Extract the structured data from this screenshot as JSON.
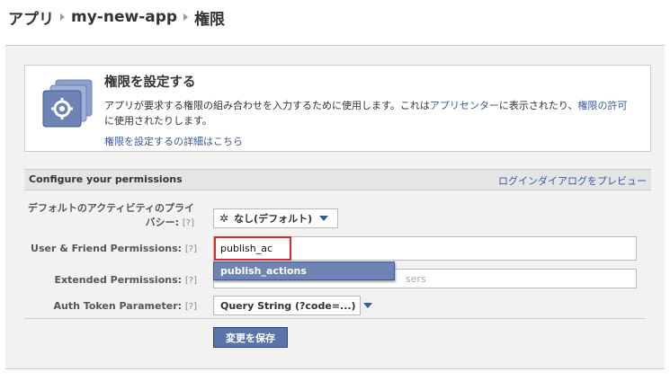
{
  "breadcrumb": {
    "items": [
      "アプリ",
      "my-new-app",
      "権限"
    ]
  },
  "info": {
    "title": "権限を設定する",
    "desc_1": "アプリが要求する権限の組み合わせを入力するために使用します。これは",
    "desc_link_1": "アプリセンター",
    "desc_2": "に表示されたり、",
    "desc_link_2": "権限の許可",
    "desc_3": "に使用されたりします。",
    "link": "権限を設定するの詳細はこちら"
  },
  "config": {
    "title": "Configure your permissions",
    "preview_link": "ログインダイアログをプレビュー"
  },
  "form": {
    "privacy_label_line1": "デフォルトのアクティビティのプライ",
    "privacy_label_line2": "バシー:",
    "privacy_value": "なし(デフォルト)",
    "user_friend_label": "User & Friend Permissions:",
    "user_friend_value": "publish_ac",
    "autocomplete_option": "publish_actions",
    "extended_label": "Extended Permissions:",
    "extended_ghost": "sers",
    "auth_label": "Auth Token Parameter:",
    "auth_value": "Query String (?code=...)",
    "help": "[?]",
    "save_label": "変更を保存"
  },
  "colors": {
    "accent": "#3b5998",
    "button": "#5b74a8",
    "highlight_border": "#d8272d",
    "dropdown_bg": "#6d84b4"
  }
}
